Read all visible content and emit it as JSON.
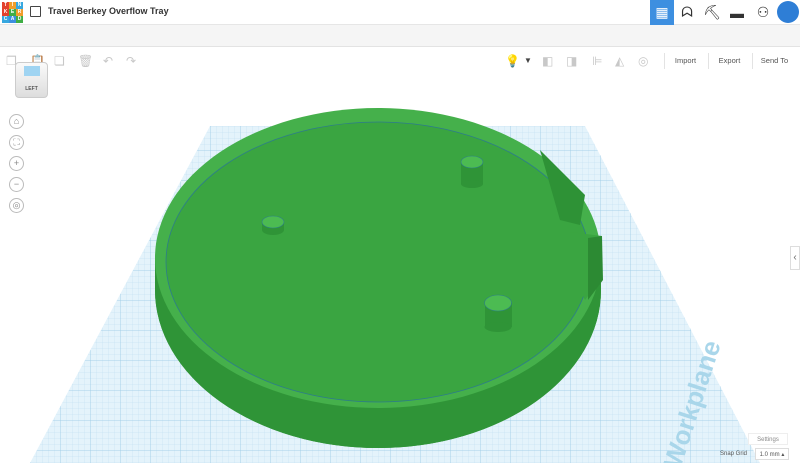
{
  "logo": {
    "letters": [
      "T",
      "I",
      "N",
      "K",
      "E",
      "R",
      "C",
      "A",
      "D"
    ]
  },
  "header": {
    "title": "Travel Berkey Overflow Tray"
  },
  "toolbar": {
    "import": "Import",
    "export": "Export",
    "send_to": "Send To"
  },
  "view_cube": {
    "face": "LEFT"
  },
  "workplane": {
    "label": "Workplane"
  },
  "footer": {
    "settings": "Settings",
    "snap_grid_label": "Snap Grid",
    "snap_grid_value": "1.0 mm ▴"
  },
  "colors": {
    "shape": "#3fae45",
    "grid": "#cfe8f5",
    "accent": "#3d8fe0"
  }
}
